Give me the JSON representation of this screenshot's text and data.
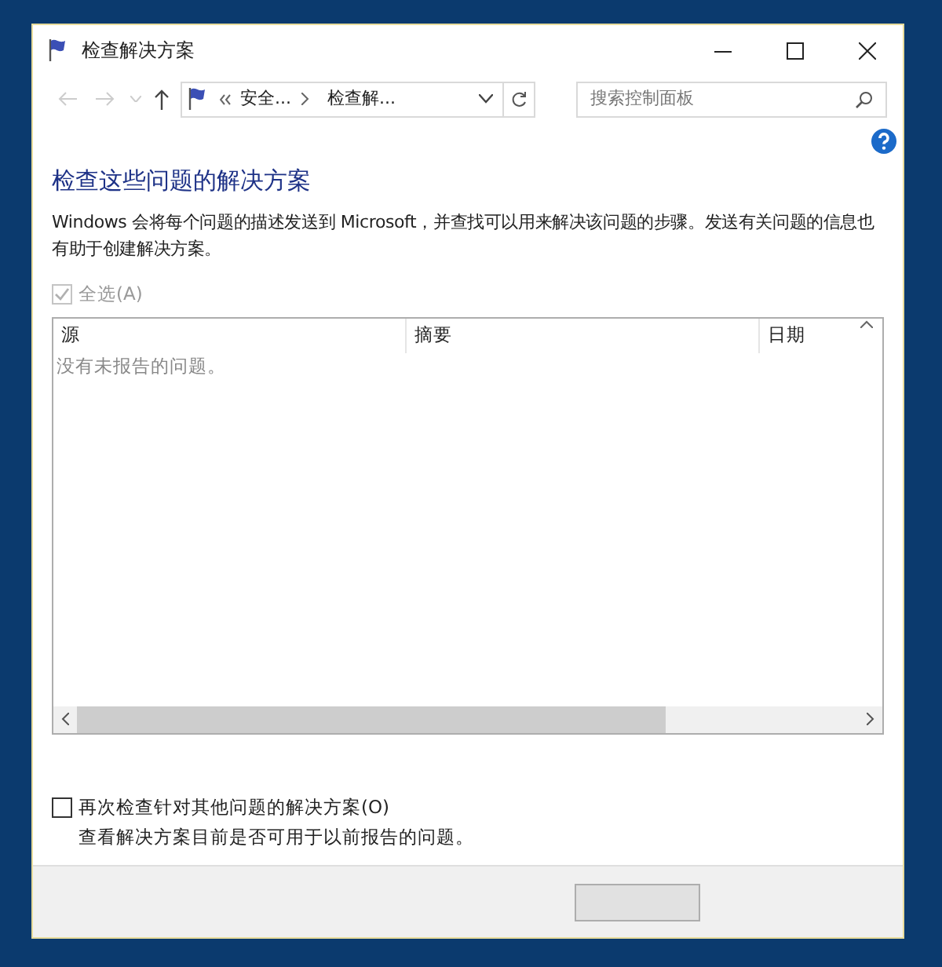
{
  "window": {
    "title": "检查解决方案"
  },
  "nav": {
    "breadcrumbs": [
      "安全...",
      "检查解..."
    ],
    "search": {
      "placeholder": "搜索控制面板"
    }
  },
  "heading": "检查这些问题的解决方案",
  "description": "Windows 会将每个问题的描述发送到 Microsoft，并查找可以用来解决该问题的步骤。发送有关问题的信息也有助于创建解决方案。",
  "select_all": {
    "label": "全选(A)",
    "checked": true,
    "disabled": true
  },
  "table": {
    "columns": [
      "源",
      "摘要",
      "日期"
    ],
    "empty_message": "没有未报告的问题。"
  },
  "recheck": {
    "label": "再次检查针对其他问题的解决方案(O)",
    "checked": false,
    "hint": "查看解决方案目前是否可用于以前报告的问题。"
  }
}
